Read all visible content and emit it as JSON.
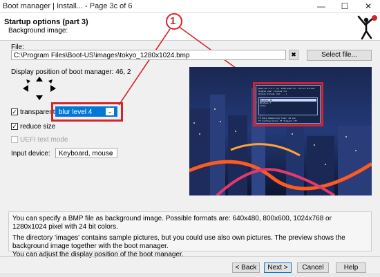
{
  "window": {
    "title": "Boot manager | Install... -  Page 3c of 6",
    "minimize": "—",
    "maximize": "☐",
    "close": "✕"
  },
  "header": {
    "title": "Startup options (part 3)",
    "subtitle": "Background image:"
  },
  "annotation": {
    "marker": "1"
  },
  "file": {
    "label": "File:",
    "path": "C:\\Program Files\\Boot-US\\images\\tokyo_1280x1024.bmp",
    "clear": "✖",
    "select_button": "Select file..."
  },
  "position": {
    "label": "Display position of boot manager: 46, 2"
  },
  "options": {
    "transparent_label": "transparent",
    "transparent_checked": true,
    "blur_value": "blur level 4",
    "reduce_label": "reduce size",
    "reduce_checked": true,
    "uefi_label": "UEFI text mode",
    "uefi_checked": false
  },
  "input_device": {
    "label": "Input device:",
    "value": "Keyboard, mouse"
  },
  "preview_menu": {
    "header_line1": "Boot-US 4.2.1  (C) 1998-2021  Dr. Ulrich Straub",
    "header_line2": "Single user licence for",
    "header_line3": "Ulrich Straub (Id: ...)",
    "items": [
      "Windows 10",
      "Windows 7",
      "Linux"
    ],
    "footer_line1": "F1  Help             Remaining time:  29 sec",
    "footer_line2": "F2  Configuration    F3  Timeout off"
  },
  "info": {
    "line1": "You can specify a BMP file as background image. Possible formats are: 640x480, 800x600, 1024x768 or 1280x1024 pixel with 24 bit colors.",
    "line2": "The directory 'images' contains sample pictures, but you could use also own pictures. The preview shows the background image together with the boot manager.",
    "line3": "You can adjust the display position of the boot manager."
  },
  "footer": {
    "back": "< Back",
    "next": "Next >",
    "cancel": "Cancel",
    "help": "Help"
  },
  "colors": {
    "highlight": "#d6232b",
    "selection": "#0078d7"
  }
}
